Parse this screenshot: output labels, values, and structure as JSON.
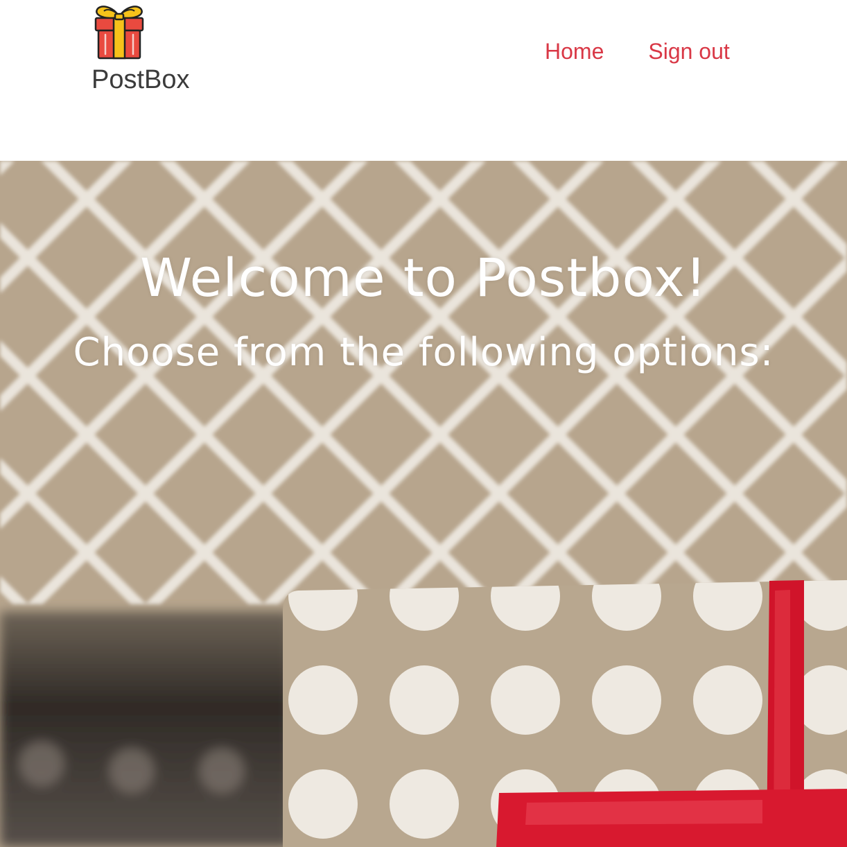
{
  "header": {
    "brand_name": "PostBox",
    "logo_icon": "gift-box-icon",
    "nav": [
      {
        "label": "Home"
      },
      {
        "label": "Sign out"
      }
    ]
  },
  "hero": {
    "title": "Welcome to Postbox!",
    "subtitle": "Choose from the following options:",
    "background_image": "wrapped-gift-photo"
  },
  "colors": {
    "nav_link": "#d93846",
    "brand_text": "#3b3b3b",
    "hero_text": "#ffffff",
    "ribbon_red": "#d0142a",
    "kraft_paper": "#b7a58d"
  }
}
